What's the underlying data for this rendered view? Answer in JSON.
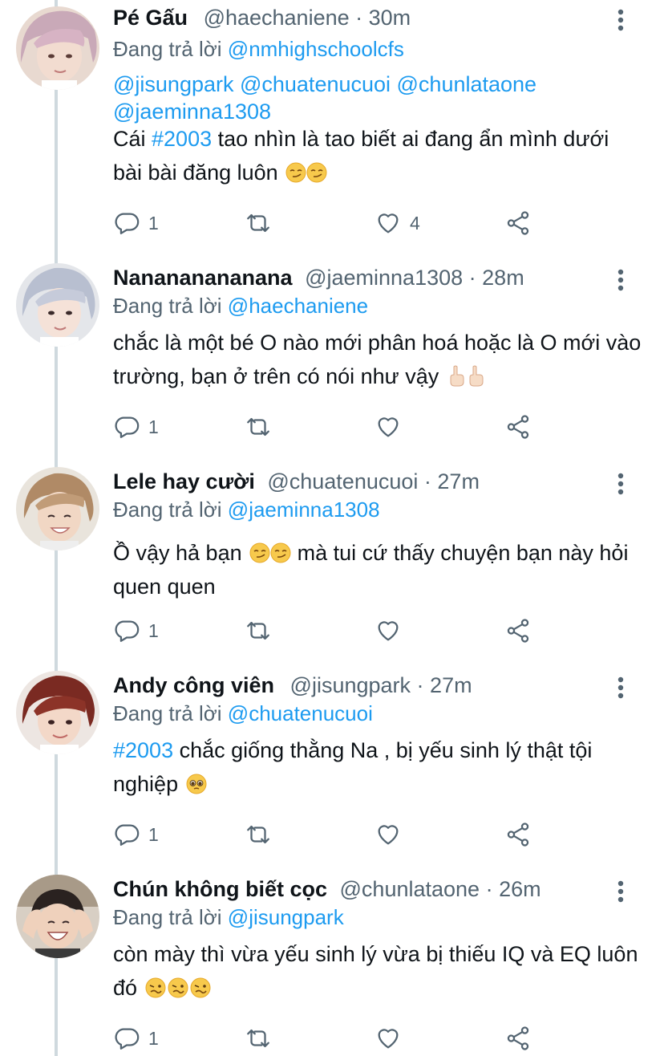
{
  "colors": {
    "link": "#1d9bf0",
    "text": "#0f1419",
    "secondary": "#536471",
    "thread_line": "#cfd9de"
  },
  "reply_prefix": "Đang trả lời",
  "tweets": [
    {
      "display_name": "Pé Gấu",
      "handle": "@haechaniene",
      "time": "30m",
      "replying_to": "@nmhighschoolcfs",
      "mentions": "@jisungpark @chuatenucuoi @chunlataone @jaeminna1308",
      "hashtag": "#2003",
      "text": "Cái ",
      "text_after_hashtag": " tao nhìn là tao biết ai đang ẩn mình dưới bài bài đăng luôn",
      "emoji": "smirking-face x2",
      "reply_count": "1",
      "like_count": "4"
    },
    {
      "display_name": "Nanananananana",
      "handle": "@jaeminna1308",
      "time": "28m",
      "replying_to": "@haechaniene",
      "text": "chắc là một bé O nào mới phân hoá hoặc là O mới vào trường, bạn ở trên có nói như vậy",
      "emoji": "pointing-up x2",
      "reply_count": "1"
    },
    {
      "display_name": "Lele hay cười",
      "handle": "@chuatenucuoi",
      "time": "27m",
      "replying_to": "@jaeminna1308",
      "text": "Ồ vậy hả bạn",
      "text_after_emoji": " mà tui cứ thấy chuyện bạn này hỏi quen quen",
      "emoji": "smirking-face x2",
      "reply_count": "1"
    },
    {
      "display_name": "Andy công viên",
      "handle": "@jisungpark",
      "time": "27m",
      "replying_to": "@chuatenucuoi",
      "hashtag": "#2003",
      "text_after_hashtag": " chắc giống thằng Na , bị yếu sinh lý thật tội nghiệp",
      "emoji": "pleading-face",
      "reply_count": "1"
    },
    {
      "display_name": "Chún không biết cọc",
      "handle": "@chunlataone",
      "time": "26m",
      "replying_to": "@jisungpark",
      "text": "còn mày thì vừa yếu sinh lý vừa bị thiếu IQ và EQ luôn đó",
      "emoji": "woozy-face x3",
      "reply_count": "1"
    }
  ],
  "icons": {
    "reply": "reply-icon",
    "retweet": "retweet-icon",
    "like": "heart-icon",
    "share": "share-icon",
    "more": "more-vertical-icon"
  }
}
